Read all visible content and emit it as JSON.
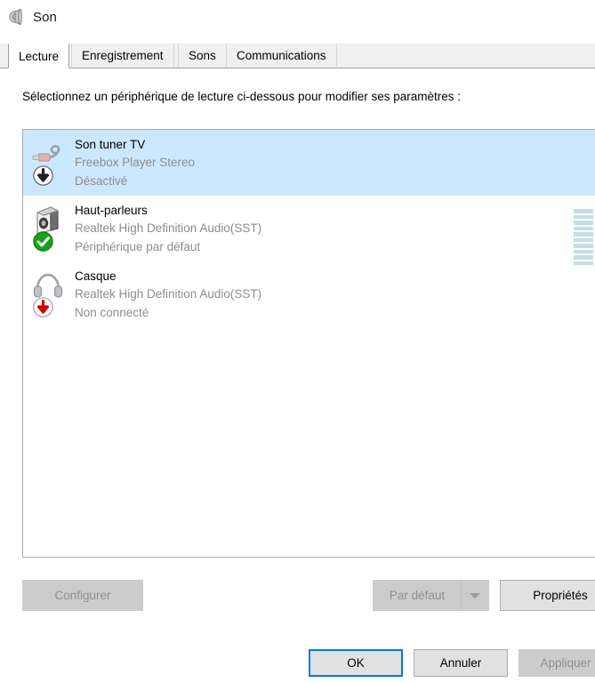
{
  "window": {
    "title": "Son",
    "icon": "speaker-icon"
  },
  "tabs": [
    {
      "label": "Lecture",
      "active": true
    },
    {
      "label": "Enregistrement",
      "active": false
    },
    {
      "label": "Sons",
      "active": false
    },
    {
      "label": "Communications",
      "active": false
    }
  ],
  "main": {
    "description": "Sélectionnez un périphérique de lecture ci-dessous pour modifier ses paramètres :"
  },
  "devices": [
    {
      "name": "Son tuner TV",
      "driver": "Freebox Player Stereo",
      "status": "Désactivé",
      "icon": "audio-cable-icon",
      "badge": "disabled-badge",
      "selected": true,
      "meter": false,
      "meter_segments": 0
    },
    {
      "name": "Haut-parleurs",
      "driver": "Realtek High Definition Audio(SST)",
      "status": "Périphérique par défaut",
      "icon": "speaker-box-icon",
      "badge": "default-check-badge",
      "selected": false,
      "meter": true,
      "meter_segments": 10
    },
    {
      "name": "Casque",
      "driver": "Realtek High Definition Audio(SST)",
      "status": "Non connecté",
      "icon": "headphones-icon",
      "badge": "not-connected-badge",
      "selected": false,
      "meter": false,
      "meter_segments": 0
    }
  ],
  "buttons": {
    "configure": {
      "label": "Configurer",
      "disabled": true
    },
    "set_default": {
      "label": "Par défaut",
      "disabled": true
    },
    "set_default_arrow": {
      "icon": "chevron-down-icon",
      "disabled": true
    },
    "properties": {
      "label": "Propriétés",
      "disabled": false
    },
    "ok": {
      "label": "OK",
      "disabled": false,
      "focused": true
    },
    "cancel": {
      "label": "Annuler",
      "disabled": false
    },
    "apply": {
      "label": "Appliquer",
      "disabled": true
    }
  },
  "colors": {
    "selection": "#cce8ff",
    "focus_border": "#0078d7",
    "default_badge_green": "#1aa11a",
    "not_connected_red": "#d40000",
    "meter_bar": "#c5dee5",
    "muted_text": "#8d8d8d"
  }
}
